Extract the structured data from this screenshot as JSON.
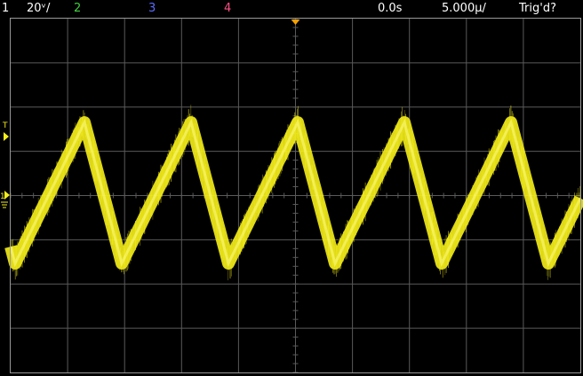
{
  "status_bar": {
    "ch1_number": "1",
    "ch1_scale": "20ᵛ/",
    "ch2_label": "2",
    "ch3_label": "3",
    "ch4_label": "4",
    "time_delay": "0.0s",
    "time_scale": "5.000µ/",
    "trigger_status": "Trig'd?"
  },
  "colors": {
    "background": "#000000",
    "grid": "#5a5a5a",
    "frame": "#9a9a9a",
    "ch1": "#f5ee1a",
    "ch2": "#3fd23f",
    "ch3": "#5a6cff",
    "ch4": "#ff4f86",
    "trigger_marker": "#f5a000",
    "text": "#ffffff"
  },
  "markers": {
    "trigger_level_label": "T",
    "ground_label": "1"
  },
  "waveform": {
    "shape": "triangle",
    "cycles_visible": 5.2,
    "noise": true
  }
}
